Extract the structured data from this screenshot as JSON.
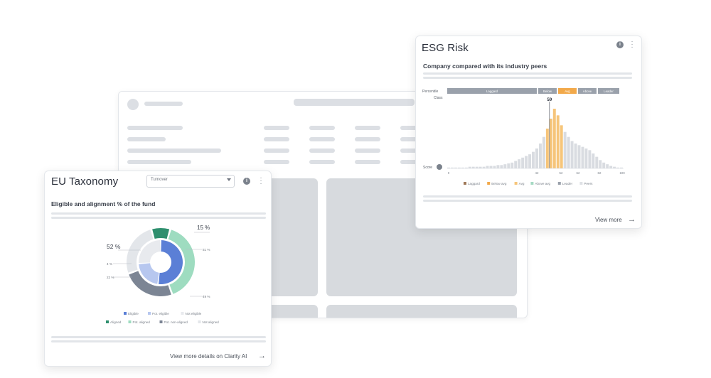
{
  "eu_taxonomy": {
    "title": "EU Taxonomy",
    "select_value": "Turnover",
    "subtitle": "Eligible and alignment % of the fund",
    "footer_link": "View more details on Clarity AI",
    "colors": {
      "eligible_inner": "#5b7fd6",
      "pot_eligible_inner": "#b7c7ef",
      "not_eligible_inner": "#e8eaee",
      "aligned": "#2e8f6e",
      "pot_aligned": "#9edcc0",
      "pot_not_aligned": "#7c8594",
      "not_aligned": "#e3e6ea"
    },
    "chart_data": {
      "type": "pie",
      "labels": {
        "outer_top": "15 %",
        "left_main": "52 %",
        "outer_right_1": "31 %",
        "outer_right_2": "49 %",
        "inner_left_1": "4 %",
        "inner_left_2": "22 %"
      },
      "inner_ring": [
        {
          "name": "Eligible",
          "value": 52
        },
        {
          "name": "Pot. eligible",
          "value": 22
        },
        {
          "name": "Not eligible",
          "value": 26
        }
      ],
      "outer_ring": [
        {
          "name": "Aligned",
          "value": 9
        },
        {
          "name": "Pot. aligned",
          "value": 40
        },
        {
          "name": "Pot. non-aligned",
          "value": 25
        },
        {
          "name": "Not aligned",
          "value": 26
        }
      ],
      "legend_row1": [
        "Eligible",
        "Pot. eligible",
        "Not eligible"
      ],
      "legend_row2": [
        "Aligned",
        "Pot. aligned",
        "Pot. non-aligned",
        "Not aligned"
      ]
    }
  },
  "esg_risk": {
    "title": "ESG Risk",
    "subtitle": "Company compared with its industry peers",
    "footer_link": "View more",
    "colors": {
      "bar": "#d9dce1",
      "highlight": "#f6c57a",
      "band": "#9aa1ab",
      "band_active": "#f2a94a"
    },
    "chart_data": {
      "type": "bar",
      "row_labels": [
        "Percentile",
        "Class"
      ],
      "score_label": "Score",
      "marker_value": "59",
      "bands": [
        "Laggard",
        "Below",
        "Avg",
        "Above",
        "Leader"
      ],
      "active_band": "Avg",
      "x_ticks": [
        "0",
        "42",
        "52",
        "62",
        "82",
        "100"
      ],
      "highlight_range": [
        56,
        64
      ],
      "x": [
        0,
        2,
        4,
        6,
        8,
        10,
        12,
        14,
        16,
        18,
        20,
        22,
        24,
        26,
        28,
        30,
        32,
        34,
        36,
        38,
        40,
        42,
        44,
        46,
        48,
        50,
        52,
        54,
        56,
        58,
        60,
        62,
        64,
        66,
        68,
        70,
        72,
        74,
        76,
        78,
        80,
        82,
        84,
        86,
        88,
        90,
        92,
        94,
        96,
        98
      ],
      "values": [
        1,
        1,
        1,
        1,
        1,
        1,
        2,
        2,
        2,
        2,
        2,
        3,
        3,
        3,
        4,
        4,
        5,
        6,
        7,
        9,
        11,
        13,
        15,
        17,
        20,
        24,
        30,
        38,
        48,
        60,
        72,
        64,
        52,
        44,
        38,
        33,
        30,
        28,
        26,
        24,
        22,
        18,
        14,
        10,
        7,
        5,
        3,
        2,
        1,
        1
      ],
      "legend": [
        "Laggard",
        "Below avg",
        "Avg",
        "Above avg",
        "Leader",
        "Peers"
      ]
    }
  }
}
